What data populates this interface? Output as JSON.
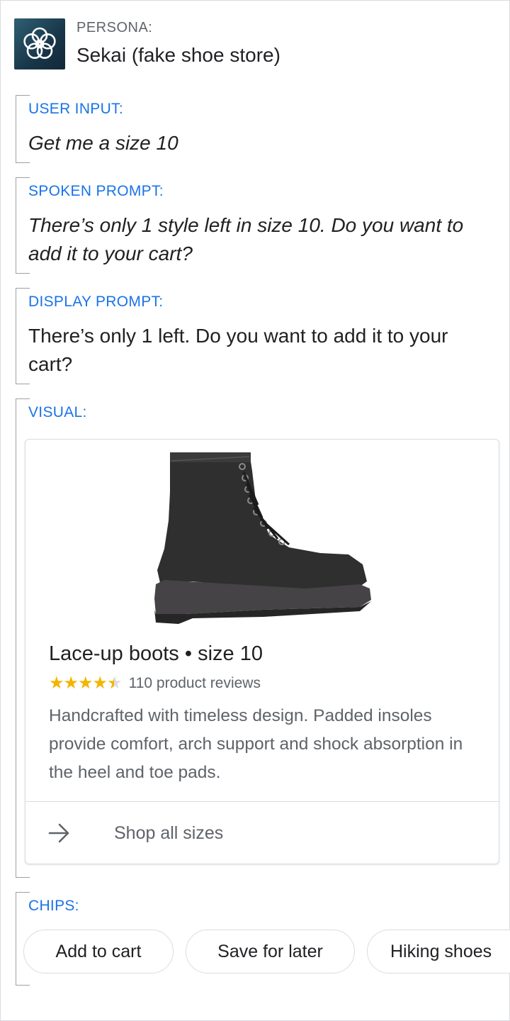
{
  "persona": {
    "label": "PERSONA:",
    "name": "Sekai (fake shoe store)",
    "icon": "flower-logo-icon"
  },
  "user_input": {
    "label": "USER INPUT:",
    "text": "Get me a size 10"
  },
  "spoken_prompt": {
    "label": "SPOKEN PROMPT:",
    "text": "There’s only 1 style left in size 10. Do you want to add it to your cart?"
  },
  "display_prompt": {
    "label": "DISPLAY PROMPT:",
    "text": "There’s only 1 left. Do you want to add it to your cart?"
  },
  "visual": {
    "label": "VISUAL:",
    "card": {
      "image": "boot-image",
      "title": "Lace-up boots • size 10",
      "rating": 4.5,
      "rating_max": 5,
      "reviews": "110 product reviews",
      "description": "Handcrafted with timeless design. Padded insoles provide comfort, arch support and shock absorption in the heel and toe pads.",
      "action_icon": "arrow-right-icon",
      "action_label": "Shop all sizes"
    }
  },
  "chips": {
    "label": "CHIPS:",
    "items": [
      "Add to cart",
      "Save for later",
      "Hiking shoes"
    ]
  },
  "colors": {
    "accent": "#1a73e8",
    "star": "#f4b400",
    "secondary_text": "#5f6368"
  }
}
